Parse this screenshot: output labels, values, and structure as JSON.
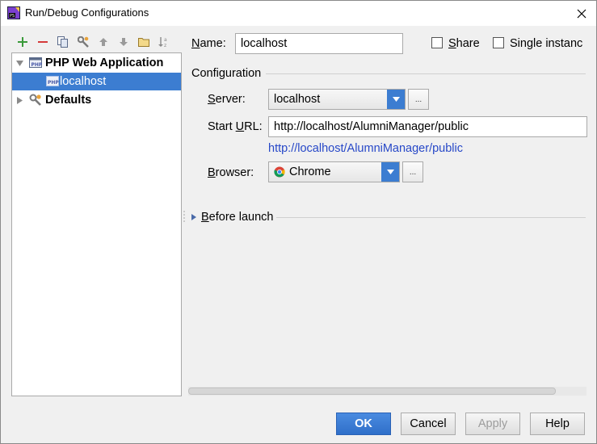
{
  "window": {
    "title": "Run/Debug Configurations",
    "app_icon": "phpstorm-icon",
    "close_icon": "close-icon"
  },
  "toolbar": {
    "icons": [
      "add-icon",
      "remove-icon",
      "copy-icon",
      "wrench-icon",
      "move-up-icon",
      "move-down-icon",
      "folder-icon",
      "sort-icon"
    ]
  },
  "tree": {
    "items": [
      {
        "label": "PHP Web Application",
        "level": 0,
        "expanded": true,
        "bold": true,
        "icon": "php-app-icon"
      },
      {
        "label": "localhost",
        "level": 1,
        "selected": true,
        "icon": "php-config-icon"
      },
      {
        "label": "Defaults",
        "level": 0,
        "expanded": false,
        "bold": true,
        "icon": "defaults-wrench-icon"
      }
    ]
  },
  "form": {
    "name_label_mnemonic": "N",
    "name_label_rest": "ame:",
    "name_value": "localhost",
    "share_label_mnemonic": "S",
    "share_label_rest": "hare",
    "single_instance_label": "Single instanc",
    "configuration_title": "Configuration",
    "server_label_mnemonic": "S",
    "server_label_rest": "erver:",
    "server_value": "localhost",
    "ellipsis": "...",
    "start_url_label_pre": "Start ",
    "start_url_label_mnemonic": "U",
    "start_url_label_post": "RL:",
    "start_url_value": "http://localhost/AlumniManager/public",
    "resolved_url": "http://localhost/AlumniManager/public",
    "browser_label_mnemonic": "B",
    "browser_label_rest": "rowser:",
    "browser_value": "Chrome",
    "before_launch_mnemonic": "B",
    "before_launch_rest": "efore launch"
  },
  "buttons": {
    "ok": "OK",
    "cancel": "Cancel",
    "apply": "Apply",
    "help": "Help"
  },
  "colors": {
    "selection": "#3c7dd1",
    "link": "#2748c8",
    "add_green": "#3a9a3a",
    "remove_red": "#d43a3a"
  }
}
